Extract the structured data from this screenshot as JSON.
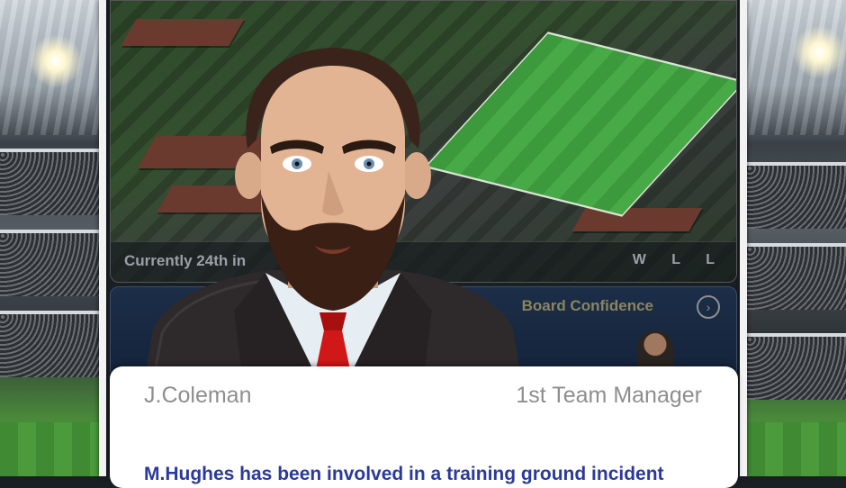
{
  "map": {
    "status_text": "Currently 24th in",
    "form_guide": "W L L"
  },
  "board": {
    "title": "Board Confidence",
    "arrow_icon": "chevron-right-icon"
  },
  "dialog": {
    "speaker_name": "J.Coleman",
    "speaker_role": "1st Team Manager",
    "message": "M.Hughes has been involved in a training ground incident"
  },
  "colors": {
    "message_text": "#2a3a9c",
    "speaker_text": "#8e8e8e",
    "board_title": "#8a8560",
    "tie": "#d01818"
  }
}
